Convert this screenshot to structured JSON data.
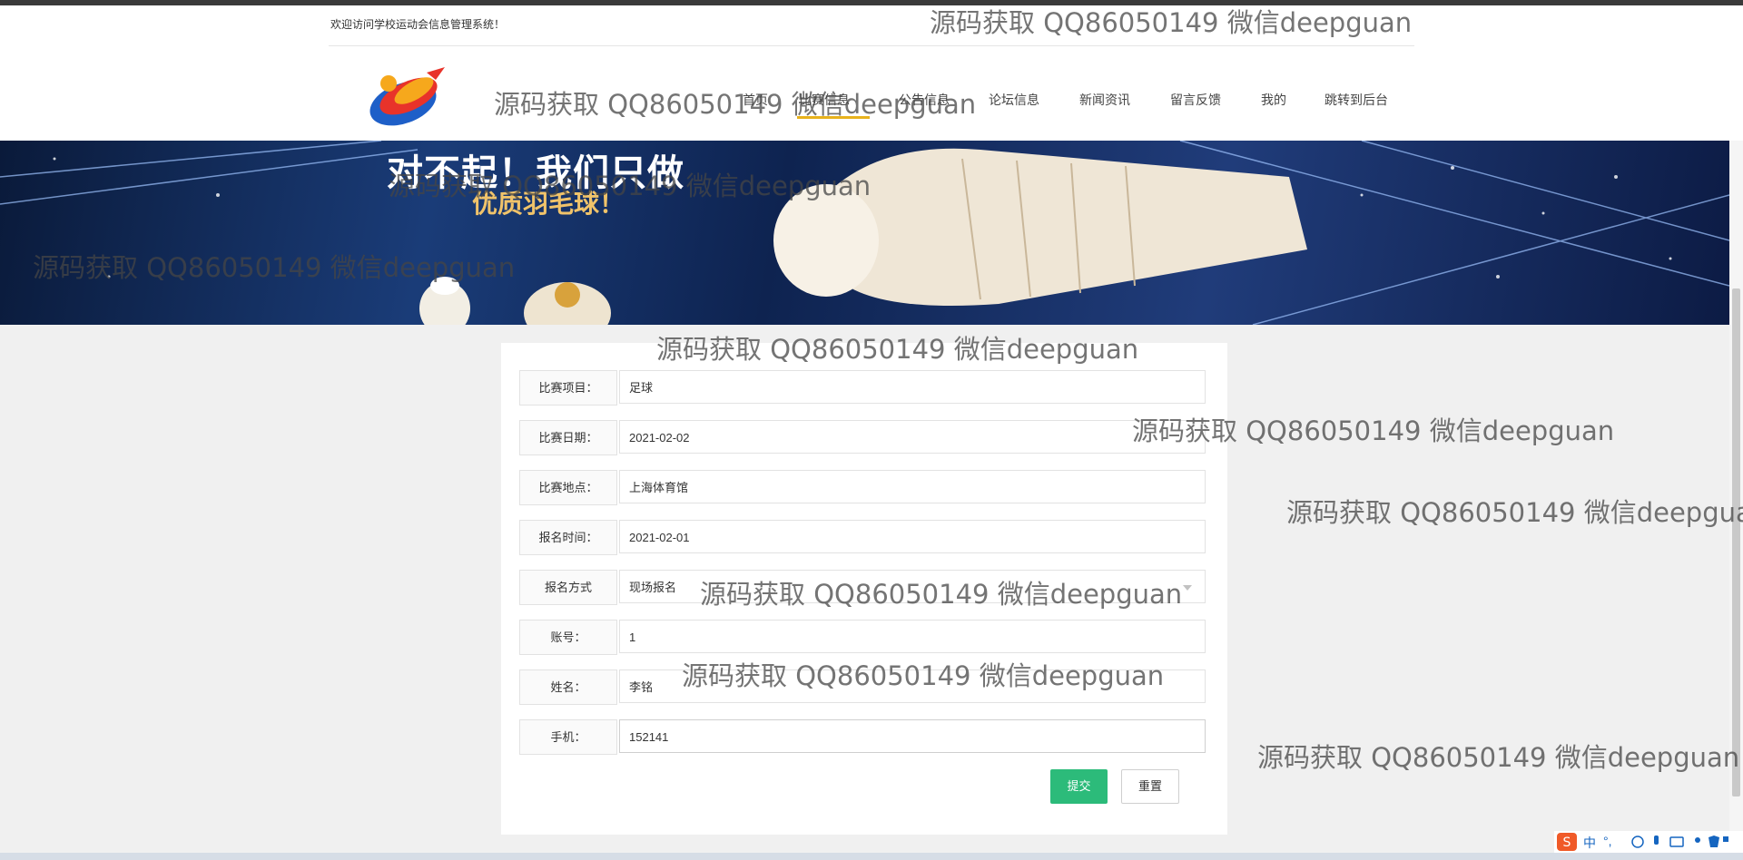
{
  "header": {
    "welcome": "欢迎访问学校运动会信息管理系统！",
    "nav": [
      {
        "label": "首页"
      },
      {
        "label": "比赛信息"
      },
      {
        "label": "公告信息"
      },
      {
        "label": "论坛信息"
      },
      {
        "label": "新闻资讯"
      },
      {
        "label": "留言反馈"
      },
      {
        "label": "我的"
      },
      {
        "label": "跳转到后台"
      }
    ],
    "accent_color": "#e8b21c"
  },
  "banner": {
    "line1": "对不起！我们只做",
    "line2": "优质羽毛球！"
  },
  "form": {
    "fields": [
      {
        "label": "比赛项目：",
        "value": "足球"
      },
      {
        "label": "比赛日期：",
        "value": "2021-02-02"
      },
      {
        "label": "比赛地点：",
        "value": "上海体育馆"
      },
      {
        "label": "报名时间：",
        "value": "2021-02-01"
      },
      {
        "label": "报名方式",
        "value": "现场报名"
      },
      {
        "label": "账号：",
        "value": "1"
      },
      {
        "label": "姓名：",
        "value": "李铭"
      },
      {
        "label": "手机：",
        "value": "152141"
      }
    ],
    "submit_label": "提交",
    "reset_label": "重置",
    "submit_color": "#2cbb7a"
  },
  "watermark": "源码获取 QQ86050149 微信deepguan",
  "ime": {
    "mode": "中",
    "punct": "°,"
  }
}
